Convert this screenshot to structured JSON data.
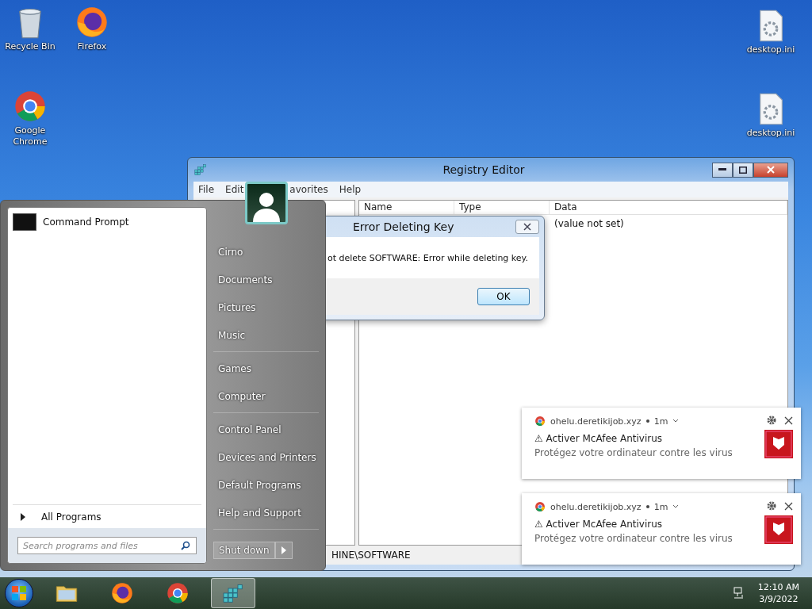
{
  "desktop_icons": [
    {
      "label": "Recycle Bin",
      "kind": "bin"
    },
    {
      "label": "Firefox",
      "kind": "firefox"
    },
    {
      "label": "desktop.ini",
      "kind": "file"
    },
    {
      "label": "Google Chrome",
      "kind": "chrome"
    },
    {
      "label": "desktop.ini",
      "kind": "file"
    }
  ],
  "registry_editor": {
    "title": "Registry Editor",
    "menu": [
      "File",
      "Edit",
      "avorites",
      "Help"
    ],
    "columns": [
      "Name",
      "Type",
      "Data"
    ],
    "rows": [
      {
        "data": "(value not set)"
      }
    ],
    "status_bar": "HINE\\SOFTWARE"
  },
  "error_dialog": {
    "title": "Error Deleting Key",
    "message": "ot delete SOFTWARE:  Error while deleting key.",
    "button": "OK"
  },
  "start_menu": {
    "pinned": [
      "Command Prompt"
    ],
    "all_programs": "All Programs",
    "search": {
      "placeholder": "Search programs and files"
    },
    "places": [
      [
        "Cirno",
        "Documents",
        "Pictures",
        "Music"
      ],
      [
        "Games",
        "Computer"
      ],
      [
        "Control Panel",
        "Devices and Printers",
        "Default Programs",
        "Help and Support"
      ]
    ],
    "shut_down": "Shut down"
  },
  "notifications": [
    {
      "site": "ohelu.deretikijob.xyz",
      "time": "1m",
      "title": "⚠ Activer McAfee Antivirus",
      "body": "Protégez votre ordinateur contre les virus"
    },
    {
      "site": "ohelu.deretikijob.xyz",
      "time": "1m",
      "title": "⚠ Activer McAfee Antivirus",
      "body": "Protégez votre ordinateur contre les virus"
    }
  ],
  "taskbar": {
    "apps": [
      {
        "kind": "folder",
        "selected": false
      },
      {
        "kind": "firefox",
        "selected": false
      },
      {
        "kind": "chrome",
        "selected": false
      },
      {
        "kind": "regedit",
        "selected": true
      }
    ],
    "time": "12:10 AM",
    "date": "3/9/2022"
  }
}
